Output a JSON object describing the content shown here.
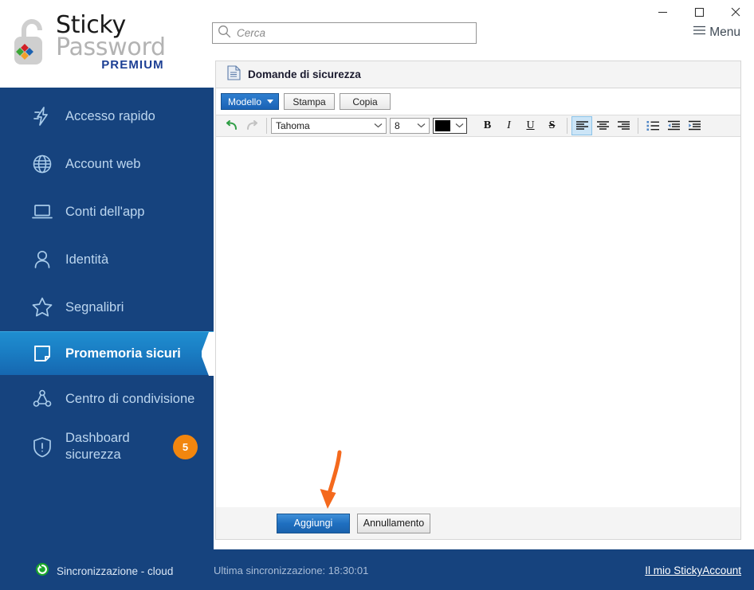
{
  "app": {
    "brand_line1": "Sticky",
    "brand_line2": "Password",
    "brand_edition": "PREMIUM",
    "accent_blue": "#16437e",
    "selected_blue": "#1a7ec4",
    "badge_orange": "#f2860e",
    "annotation_orange": "#f4691d"
  },
  "titlebar": {
    "minimize": "–",
    "maximize": "☐",
    "close": "✕",
    "menu_label": "Menu",
    "menu_icon": "hamburger-icon"
  },
  "search": {
    "value": "",
    "placeholder": "Cerca",
    "icon": "search-icon"
  },
  "sidebar": {
    "items": [
      {
        "label": "Accesso rapido",
        "icon": "lightning-icon",
        "selected": false,
        "badge": null
      },
      {
        "label": "Account web",
        "icon": "globe-icon",
        "selected": false,
        "badge": null
      },
      {
        "label": "Conti dell'app",
        "icon": "laptop-icon",
        "selected": false,
        "badge": null
      },
      {
        "label": "Identità",
        "icon": "person-icon",
        "selected": false,
        "badge": null
      },
      {
        "label": "Segnalibri",
        "icon": "star-icon",
        "selected": false,
        "badge": null
      },
      {
        "label": "Promemoria sicuri",
        "icon": "note-icon",
        "selected": true,
        "badge": null
      },
      {
        "label": "Centro di condivisione",
        "icon": "share-icon",
        "selected": false,
        "badge": null
      },
      {
        "label": "Dashboard sicurezza",
        "icon": "shield-alert-icon",
        "selected": false,
        "badge": "5"
      }
    ]
  },
  "footer": {
    "sync_label": "Sincronizzazione - cloud",
    "sync_icon": "sync-refresh-icon",
    "last_sync": "Ultima sincronizzazione: 18:30:01",
    "account_link": "Il mio StickyAccount"
  },
  "panel": {
    "title": "Domande di sicurezza",
    "title_icon": "document-icon",
    "buttons": {
      "model": "Modello",
      "print": "Stampa",
      "copy": "Copia"
    },
    "format_bar": {
      "undo_icon": "undo-icon",
      "redo_icon": "redo-icon",
      "font_family": "Tahoma",
      "font_size": "8",
      "font_color": "#000000",
      "bold": "B",
      "italic": "I",
      "underline": "U",
      "strikethrough": "S",
      "align_left_icon": "align-left-icon",
      "align_center_icon": "align-center-icon",
      "align_right_icon": "align-right-icon",
      "bullet_list_icon": "bullet-list-icon",
      "outdent_icon": "outdent-icon",
      "indent_icon": "indent-icon",
      "active_alignment": "align-left"
    },
    "editor_value": "",
    "actions": {
      "submit": "Aggiungi",
      "cancel": "Annullamento"
    }
  },
  "annotation": {
    "type": "arrow",
    "points_to": "Aggiungi",
    "color": "#f4691d"
  }
}
